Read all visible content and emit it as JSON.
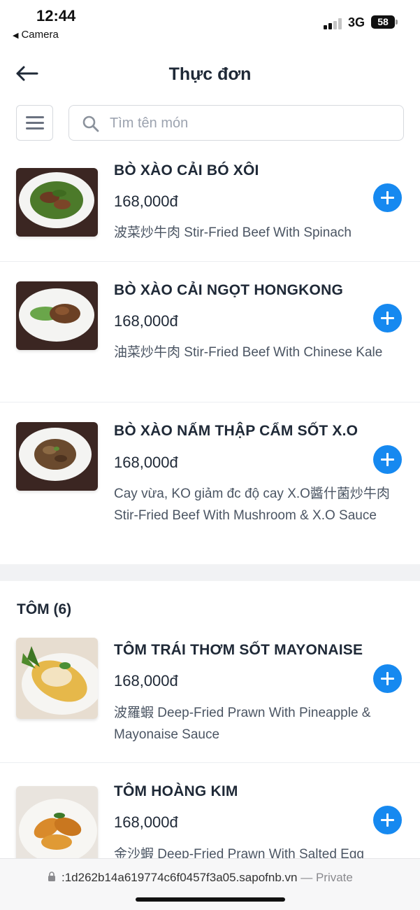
{
  "status_bar": {
    "time": "12:44",
    "back_app": "Camera",
    "network": "3G",
    "battery": "58"
  },
  "header": {
    "title": "Thực đơn"
  },
  "search": {
    "placeholder": "Tìm tên món"
  },
  "items": [
    {
      "name": "BÒ XÀO CẢI BÓ XÔI",
      "price": "168,000đ",
      "description": "波菜炒牛肉 Stir-Fried Beef With Spinach",
      "image": "beef-spinach-dish"
    },
    {
      "name": "BÒ XÀO CẢI NGỌT HONGKONG",
      "price": "168,000đ",
      "description": "油菜炒牛肉 Stir-Fried Beef With Chinese Kale",
      "image": "beef-kale-dish"
    },
    {
      "name": "BÒ XÀO NẤM THẬP CẨM SỐT X.O",
      "price": "168,000đ",
      "description": "Cay vừa, KO giảm đc độ cay X.O醬什菌炒牛肉 Stir-Fried Beef With Mushroom & X.O Sauce",
      "image": "beef-mushroom-dish"
    }
  ],
  "section": {
    "title": "TÔM (6)"
  },
  "section_items": [
    {
      "name": "TÔM TRÁI THƠM SỐT MAYONAISE",
      "price": "168,000đ",
      "description": "波羅蝦 Deep-Fried Prawn With Pineapple & Mayonaise Sauce",
      "image": "pineapple-prawn-dish"
    },
    {
      "name": "TÔM HOÀNG KIM",
      "price": "168,000đ",
      "description": "金沙蝦 Deep-Fried Prawn With Salted Egg",
      "image": "golden-prawn-dish"
    }
  ],
  "url_bar": {
    "url": ":1d262b14a619774c6f0457f3a05.sapofnb.vn",
    "suffix": "— Private"
  },
  "colors": {
    "accent": "#1689f0",
    "text": "#1f2937",
    "muted": "#4b5563"
  }
}
